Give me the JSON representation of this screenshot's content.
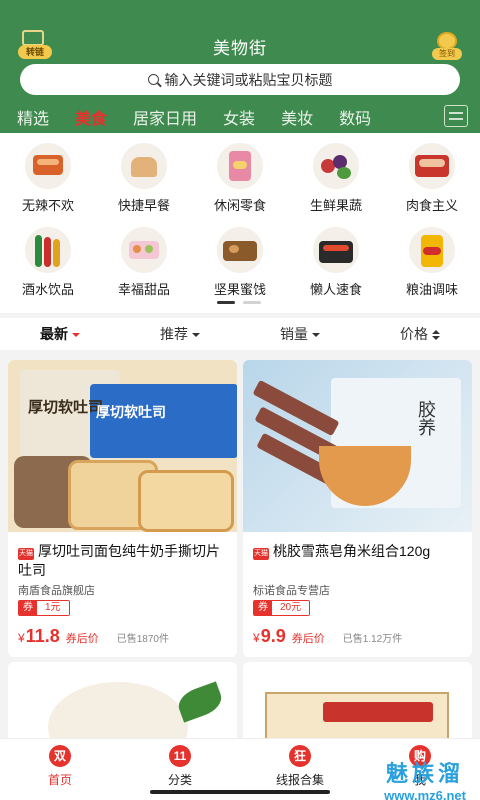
{
  "header": {
    "title": "美物街",
    "left_badge": "转链",
    "right_badge": "签到",
    "search_placeholder": "输入关键词或粘贴宝贝标题"
  },
  "tabs": [
    "精选",
    "美食",
    "居家日用",
    "女装",
    "美妆",
    "数码"
  ],
  "active_tab": "美食",
  "categories": [
    {
      "label": "无辣不欢"
    },
    {
      "label": "快捷早餐"
    },
    {
      "label": "休闲零食"
    },
    {
      "label": "生鲜果蔬"
    },
    {
      "label": "肉食主义"
    },
    {
      "label": "酒水饮品"
    },
    {
      "label": "幸福甜品"
    },
    {
      "label": "坚果蜜饯"
    },
    {
      "label": "懒人速食"
    },
    {
      "label": "粮油调味"
    }
  ],
  "sort": {
    "newest": "最新",
    "recommend": "推荐",
    "sales": "销量",
    "price": "价格"
  },
  "products": [
    {
      "store_tag": "天猫",
      "name": "厚切吐司面包纯牛奶手撕切片吐司",
      "shop": "南盾食品旗舰店",
      "coupon_label": "券",
      "coupon_value": "1元",
      "currency": "¥",
      "price": "11.8",
      "after_coupon": "券后价",
      "sold": "已售1870件",
      "image_text_a": "厚切软吐司",
      "image_text_b": "厚切软吐司"
    },
    {
      "store_tag": "天猫",
      "name": "桃胶雪燕皂角米组合120g",
      "shop": "标诺食品专营店",
      "coupon_label": "券",
      "coupon_value": "20元",
      "currency": "¥",
      "price": "9.9",
      "after_coupon": "券后价",
      "sold": "已售1.12万件",
      "image_text_a": "胶养"
    }
  ],
  "bottom_nav": [
    {
      "icon": "双",
      "label": "首页"
    },
    {
      "icon": "11",
      "label": "分类"
    },
    {
      "icon": "狂",
      "label": "线报合集"
    },
    {
      "icon": "购",
      "label": "我"
    }
  ],
  "watermark": {
    "big": "魅族溜",
    "small": "www.mz6.net"
  }
}
